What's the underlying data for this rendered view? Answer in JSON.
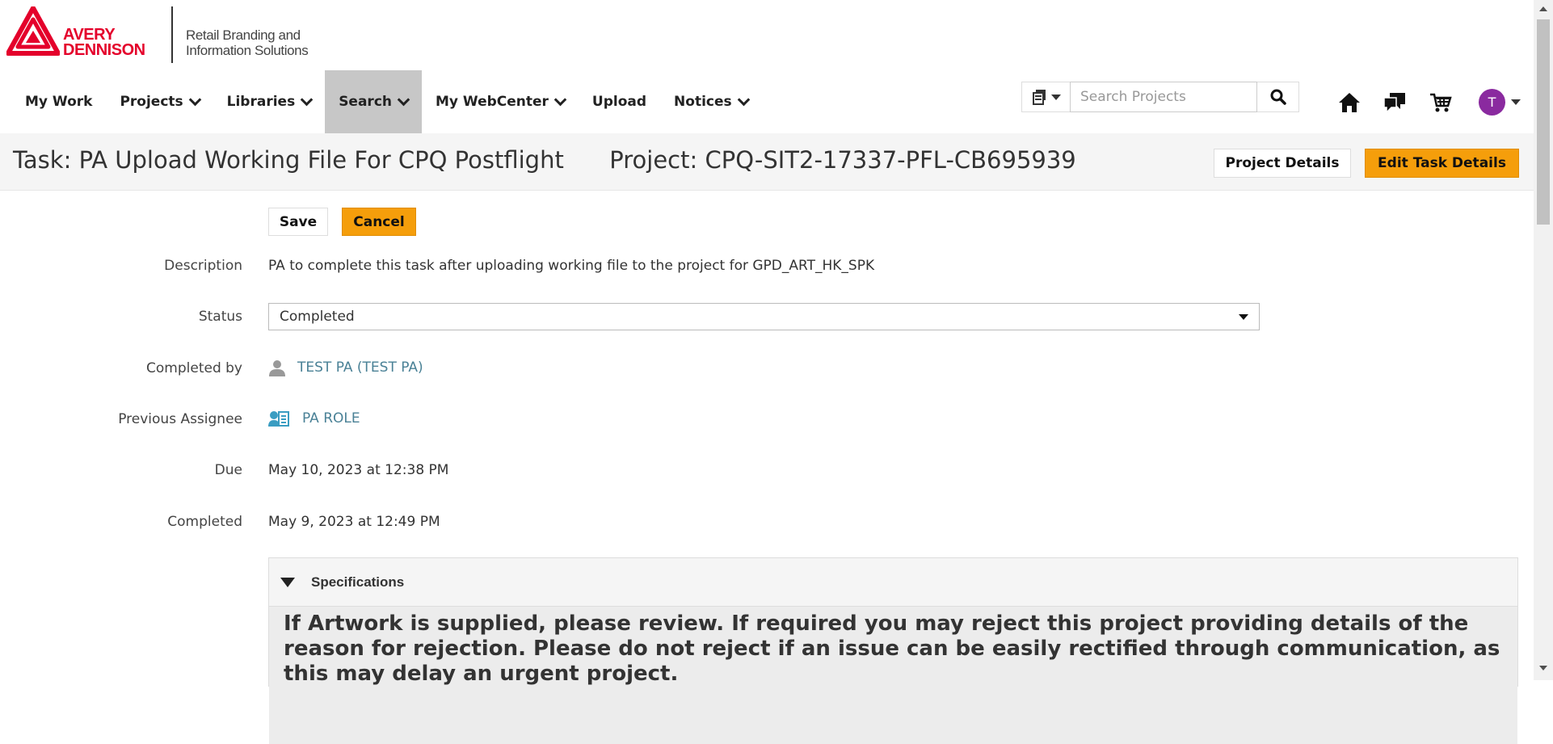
{
  "brand": {
    "name_line1": "AVERY",
    "name_line2": "DENNISON",
    "tagline_line1": "Retail Branding and",
    "tagline_line2": "Information Solutions",
    "color": "#e4002b"
  },
  "nav": {
    "items": [
      {
        "label": "My Work",
        "has_dropdown": false
      },
      {
        "label": "Projects",
        "has_dropdown": true
      },
      {
        "label": "Libraries",
        "has_dropdown": true
      },
      {
        "label": "Search",
        "has_dropdown": true,
        "active": true
      },
      {
        "label": "My WebCenter",
        "has_dropdown": true
      },
      {
        "label": "Upload",
        "has_dropdown": false
      },
      {
        "label": "Notices",
        "has_dropdown": true
      }
    ]
  },
  "search": {
    "placeholder": "Search Projects",
    "value": ""
  },
  "toolbar_icons": [
    "clipboard-icon",
    "search-icon",
    "home-icon",
    "chat-icon",
    "cart-icon"
  ],
  "user": {
    "avatar_initial": "T",
    "avatar_color": "#8a2a9f"
  },
  "task_header": {
    "task_prefix": "Task:",
    "task_name": "PA Upload Working File For CPQ Postflight",
    "project_prefix": "Project:",
    "project_name": "CPQ-SIT2-17337-PFL-CB695939",
    "project_details_label": "Project Details",
    "edit_task_label": "Edit Task Details"
  },
  "form": {
    "save_label": "Save",
    "cancel_label": "Cancel",
    "description_label": "Description",
    "description_value": "PA to complete this task after uploading working file to the project for GPD_ART_HK_SPK",
    "status_label": "Status",
    "status_value": "Completed",
    "completed_by_label": "Completed by",
    "completed_by_value": "TEST PA (TEST PA)",
    "previous_assignee_label": "Previous Assignee",
    "previous_assignee_value": "PA ROLE",
    "due_label": "Due",
    "due_value": "May 10, 2023 at 12:38 PM",
    "completed_label": "Completed",
    "completed_value": "May 9, 2023 at 12:49 PM"
  },
  "specifications": {
    "title": "Specifications",
    "text": "If Artwork is supplied, please review. If required you may reject this project providing details of the reason for rejection. Please do not reject if an issue can be easily rectified through communication, as this may delay an urgent project."
  },
  "colors": {
    "accent_button": "#f59e0b",
    "link": "#4a8196",
    "active_nav": "#c7c7c7"
  }
}
